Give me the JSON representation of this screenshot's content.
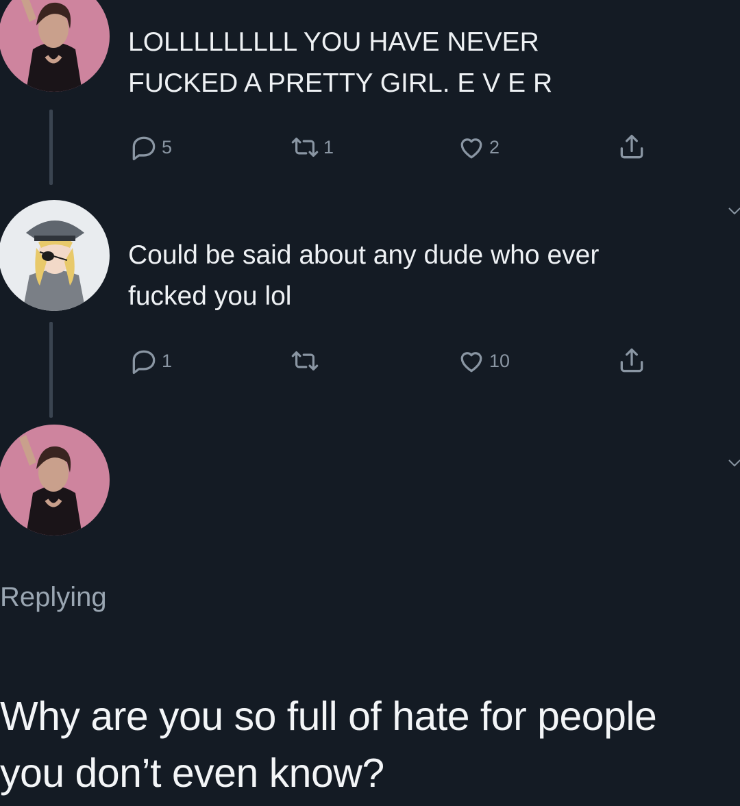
{
  "thread": [
    {
      "avatar_icon": "user-avatar-woman",
      "text_lines": [
        "LOLLLLLLLLL YOU HAVE NEVER",
        "FUCKED A PRETTY GIRL. E V E R"
      ],
      "replies": "5",
      "retweets": "1",
      "likes": "2"
    },
    {
      "avatar_icon": "user-avatar-anime",
      "text_lines": [
        "Could be said about any dude who ever",
        "fucked you lol"
      ],
      "replies": "1",
      "retweets": "",
      "likes": "10"
    },
    {
      "avatar_icon": "user-avatar-woman"
    }
  ],
  "replying_label": "Replying",
  "reply_text_lines": [
    "Why are you so full of hate for people",
    "you don’t even know?"
  ],
  "colors": {
    "background": "#141b24",
    "text": "#eef1f4",
    "muted": "#8a96a3",
    "thread_line": "#3a4450"
  }
}
